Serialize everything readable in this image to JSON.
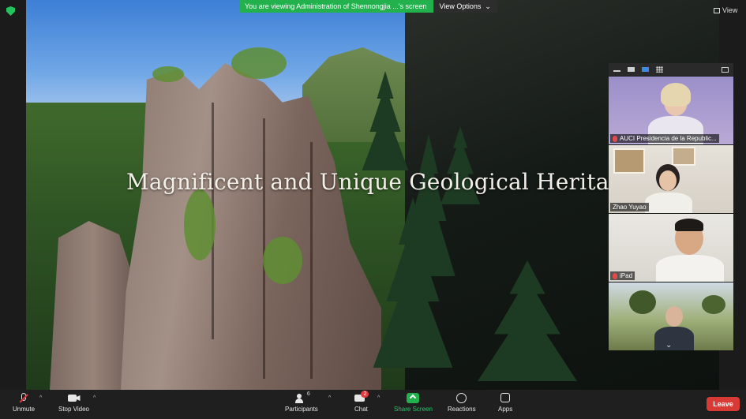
{
  "banner": {
    "viewing_text": "You are viewing Administration of Shennongjia ...'s screen",
    "view_options": "View Options",
    "view_options_caret": "⌄"
  },
  "view_button": {
    "label": "View"
  },
  "shared_content": {
    "headline": "Magnificent and Unique Geological Heritage"
  },
  "gallery": {
    "participants": [
      {
        "name": "AUCI Presidencia de la Republic...",
        "muted": true
      },
      {
        "name": "Zhao Yuyao",
        "muted": false
      },
      {
        "name": "iPad",
        "muted": true
      },
      {
        "name": "",
        "muted": false
      }
    ],
    "more_caret": "⌄"
  },
  "toolbar": {
    "unmute": "Unmute",
    "stop_video": "Stop Video",
    "participants": "Participants",
    "participants_count": "6",
    "chat": "Chat",
    "chat_badge": "2",
    "share_screen": "Share Screen",
    "reactions": "Reactions",
    "apps": "Apps",
    "leave": "Leave",
    "caret": "^"
  },
  "colors": {
    "accent_green": "#22b14c",
    "leave_red": "#d83a36",
    "active_blue": "#3d8be0"
  }
}
